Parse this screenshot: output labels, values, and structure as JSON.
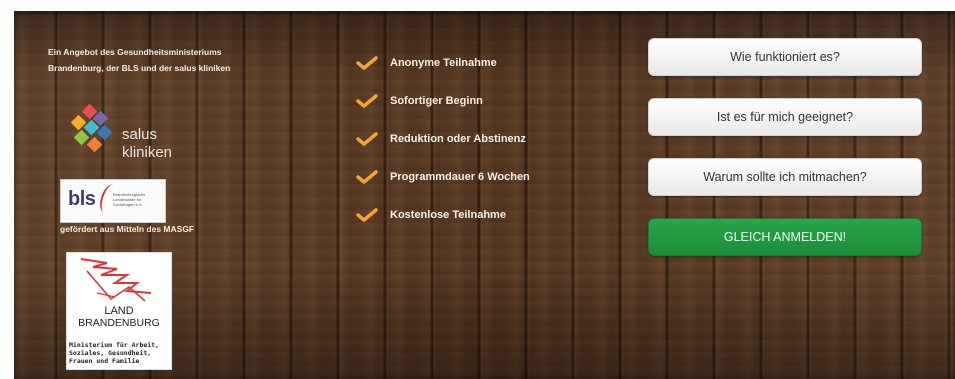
{
  "intro": {
    "line1": "Ein Angebot des Gesundheitsministeriums",
    "line2": "Brandenburg, der BLS und der salus kliniken"
  },
  "logos": {
    "salus": {
      "line1": "salus",
      "line2": "kliniken"
    },
    "bls": {
      "name": "bls",
      "small_text": "Brandenburgische Landesstelle für Suchtfragen e.V."
    },
    "funded_by": "gefördert aus Mitteln des MASGF",
    "brandenburg": {
      "title1": "LAND",
      "title2": "BRANDENBURG",
      "sub1": "Ministerium für Arbeit,",
      "sub2": "Soziales, Gesundheit,",
      "sub3": "Frauen und Familie"
    }
  },
  "features": [
    "Anonyme Teilnahme",
    "Sofortiger Beginn",
    "Reduktion oder Abstinenz",
    "Programmdauer 6 Wochen",
    "Kostenlose Teilnahme"
  ],
  "buttons": {
    "how": "Wie funktioniert es?",
    "suitable": "Ist es für mich geeignet?",
    "why": "Warum sollte ich mitmachen?",
    "register": "GLEICH ANMELDEN!"
  },
  "colors": {
    "accent_check": "#f5a431",
    "cta_green": "#209a40",
    "wood": "#5b3a22"
  }
}
